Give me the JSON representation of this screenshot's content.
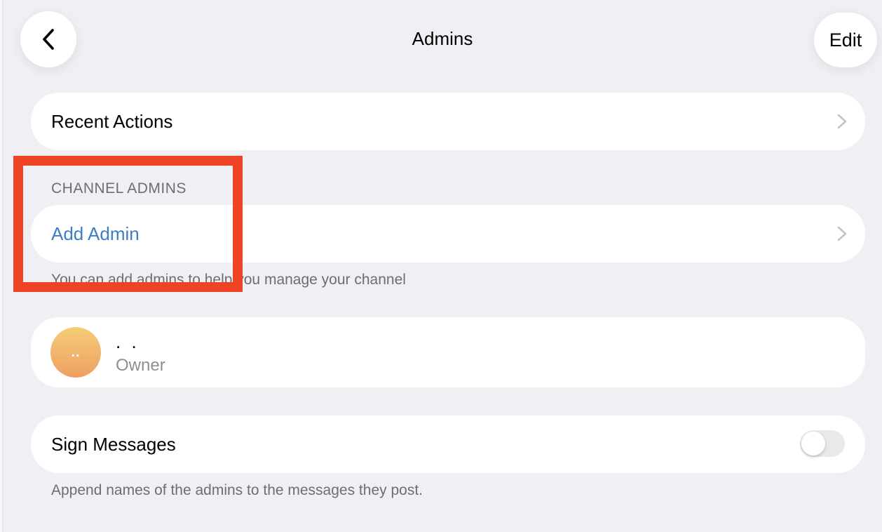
{
  "nav": {
    "title": "Admins",
    "edit_label": "Edit",
    "back_icon": "chevron-left-icon"
  },
  "recent_actions": {
    "label": "Recent Actions",
    "icon": "chevron-right-icon"
  },
  "channel_admins": {
    "header": "CHANNEL ADMINS",
    "add_admin_label": "Add Admin",
    "footnote": "You can add admins to help you manage your channel"
  },
  "admins": [
    {
      "avatar_text": "..",
      "name": ". .",
      "role": "Owner"
    }
  ],
  "sign_messages": {
    "label": "Sign Messages",
    "enabled": false,
    "footnote": "Append names of the admins to the messages they post."
  },
  "colors": {
    "accent_blue": "#3d7cc9",
    "background": "#efeff4",
    "card": "#ffffff",
    "secondary_text": "#6d6d72",
    "highlight_red": "#ee4425",
    "avatar_gradient_top": "#f6cd76",
    "avatar_gradient_bottom": "#ee9f63"
  }
}
